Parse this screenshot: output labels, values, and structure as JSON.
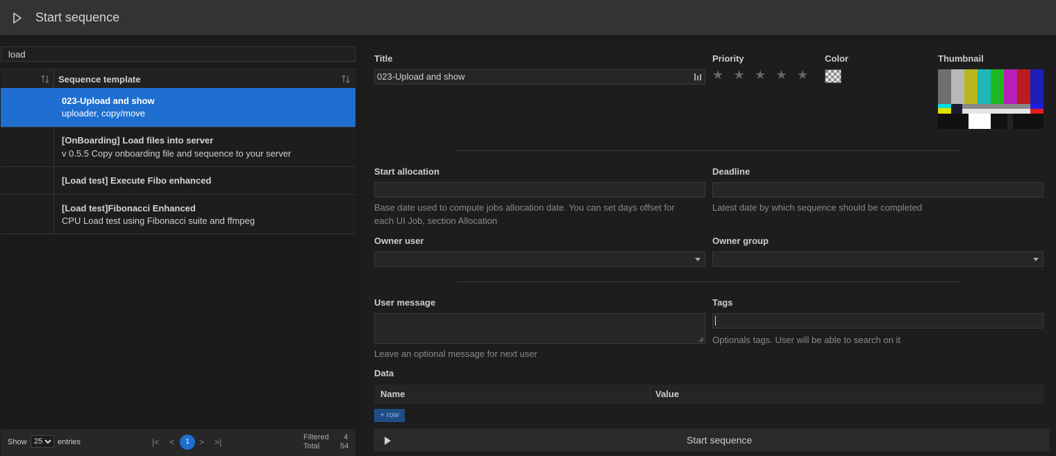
{
  "header": {
    "title": "Start sequence"
  },
  "left": {
    "search_value": "load",
    "column_header": "Sequence template",
    "rows": [
      {
        "name": "023-Upload and show",
        "desc": "uploader, copy/move",
        "selected": true
      },
      {
        "name": "[OnBoarding] Load files into server",
        "desc": "v 0.5.5 Copy onboarding file and sequence to your server"
      },
      {
        "name": "[Load test] Execute Fibo enhanced",
        "desc": ""
      },
      {
        "name": "[Load test]Fibonacci Enhanced",
        "desc": "CPU Load test using Fibonacci suite and ffmpeg"
      }
    ],
    "footer": {
      "show": "Show",
      "page_size": "25",
      "entries": "entries",
      "first": "|<",
      "prev": "<",
      "current_page": "1",
      "next": ">",
      "last": ">|",
      "filtered_label": "Filtered",
      "filtered_value": "4",
      "total_label": "Total",
      "total_value": "54"
    }
  },
  "form": {
    "title_label": "Title",
    "title_value": "023-Upload and show",
    "priority_label": "Priority",
    "priority_stars": 0,
    "priority_max": 5,
    "color_label": "Color",
    "thumbnail_label": "Thumbnail",
    "start_allocation_label": "Start allocation",
    "start_allocation_value": "",
    "start_allocation_hint_1": "Base date used to compute jobs allocation date. You can set days offset for",
    "start_allocation_hint_2": "each UI Job, section Allocation",
    "deadline_label": "Deadline",
    "deadline_value": "",
    "deadline_hint": "Latest date by which sequence should be completed",
    "owner_user_label": "Owner user",
    "owner_user_value": "",
    "owner_group_label": "Owner group",
    "owner_group_value": "",
    "user_message_label": "User message",
    "user_message_hint": "Leave an optional message for next user",
    "tags_label": "Tags",
    "tags_hint": "Optionals tags. User will be able to search on it",
    "data_label": "Data",
    "data_col_name": "Name",
    "data_col_value": "Value",
    "add_row": "+ row",
    "start_button": "Start sequence"
  },
  "colors": {
    "accent": "#1f6fd1",
    "background": "#1b1b1b",
    "header": "#333333"
  }
}
